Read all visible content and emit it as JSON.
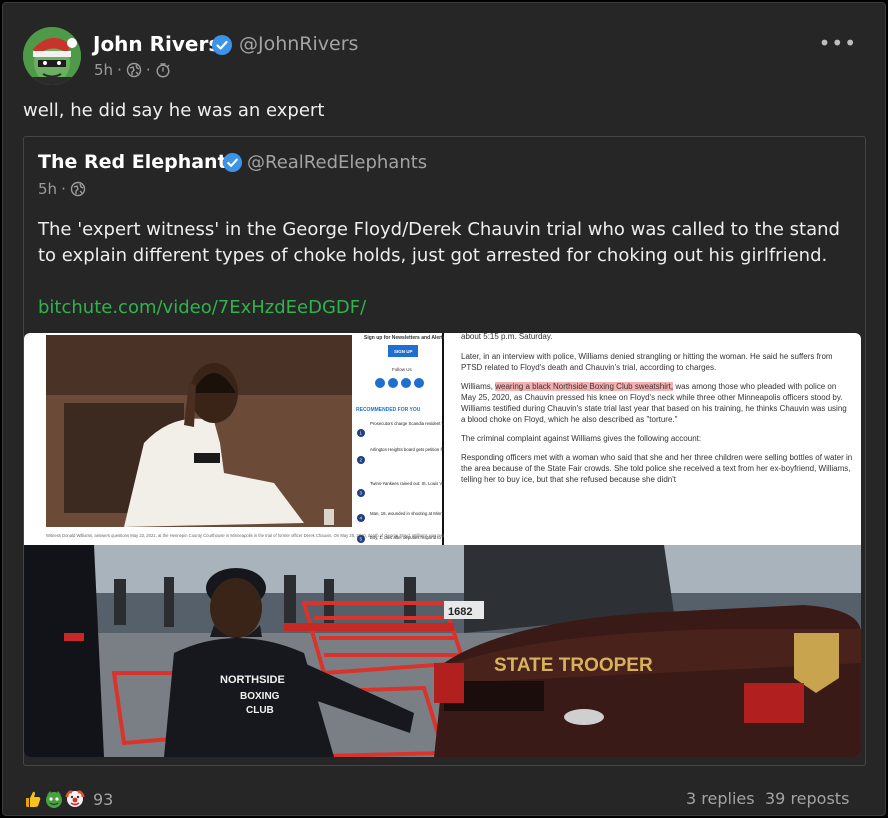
{
  "post": {
    "author_name": "John Rivers",
    "author_handle": "@JohnRivers",
    "time": "5h",
    "meta_separator": "·",
    "text": "well, he did say he was an expert",
    "more_label": "•••"
  },
  "quote": {
    "author_name": "The Red Elephants",
    "author_handle": "@RealRedElephants",
    "time": "5h",
    "meta_separator": "·",
    "body": "The 'expert witness' in the George Floyd/Derek Chauvin trial who was called to the stand to explain different types of choke holds, just got arrested for choking out his girlfriend.",
    "link": "bitchute.com/video/7ExHzdEeDGDF/",
    "media": {
      "article_sidebar": {
        "signup": "Sign up for Newsletters and Alerts",
        "signup_button": "SIGN UP",
        "follow_us": "Follow Us",
        "recommended": "RECOMMENDED FOR YOU",
        "items": [
          "Prosecutors charge Scandia resident with felonies in weekend road rage incident",
          "Arlington Heights board gets petition from Kuth brothers backed group calling for lawsuit may impact Chicago Bears' stadium plans",
          "Twins-Yankees rained out: St. Louis Varland set to make Twins debut Wednesday at Yankee Stadium",
          "Man, 18, wounded in shooting at Minnesota State fairgrounds",
          "Boy, 1, dies after deputies respond to report of possible overdose"
        ],
        "item_numbers": [
          "1",
          "2",
          "3",
          "4",
          "5"
        ],
        "caption": "Witness Donald Williams, answers questions May 23, 2021, at the Hennepin County Courthouse in Minneapolis in the trial of former officer Derek Chauvin. On May 25, 2020, death of George Floyd. Williams was testifying about what he saw of Floyd's arrest. (Court TV via AP, Pool)"
      },
      "article_text": {
        "p0": "about 5:15 p.m. Saturday.",
        "p1": "Later, in an interview with police, Williams denied strangling or hitting the woman. He said he suffers from PTSD related to Floyd's death and Chauvin's trial, according to charges.",
        "p2_pre": "Williams, ",
        "p2_highlight": "wearing a black Northside Boxing Club sweatshirt,",
        "p2_post": " was among those who pleaded with police on May 25, 2020, as Chauvin pressed his knee on Floyd's neck while three other Minneapolis officers stood by. Williams testified during Chauvin's state trial last year that based on his training, he thinks Chauvin was using a blood choke on Floyd, which he also described as \"torture.\"",
        "p3": "The criminal complaint against Williams gives the following account:",
        "p4": "Responding officers met with a woman who said that she and her three children were selling bottles of water in the area because of the State Fair crowds. She told police she received a text from her ex-boyfriend, Williams, telling her to buy ice, but that she refused because she didn't"
      },
      "bottom_photo": {
        "hoodie_text_1": "NORTHSIDE",
        "hoodie_text_2": "BOXING",
        "hoodie_text_3": "CLUB",
        "trooper_text": "STATE TROOPER",
        "plate": "1682"
      }
    }
  },
  "footer": {
    "react_count": "93",
    "replies": "3 replies",
    "reposts": "39 reposts"
  },
  "colors": {
    "background": "#262626",
    "link": "#2fb34b",
    "verified": "#3b94e8",
    "highlight": "#f6b0b0"
  },
  "icons": [
    "verified-badge-icon",
    "globe-icon",
    "clock-icon",
    "more-icon",
    "thumbs-up-reaction",
    "green-monster-reaction",
    "clown-reaction"
  ]
}
